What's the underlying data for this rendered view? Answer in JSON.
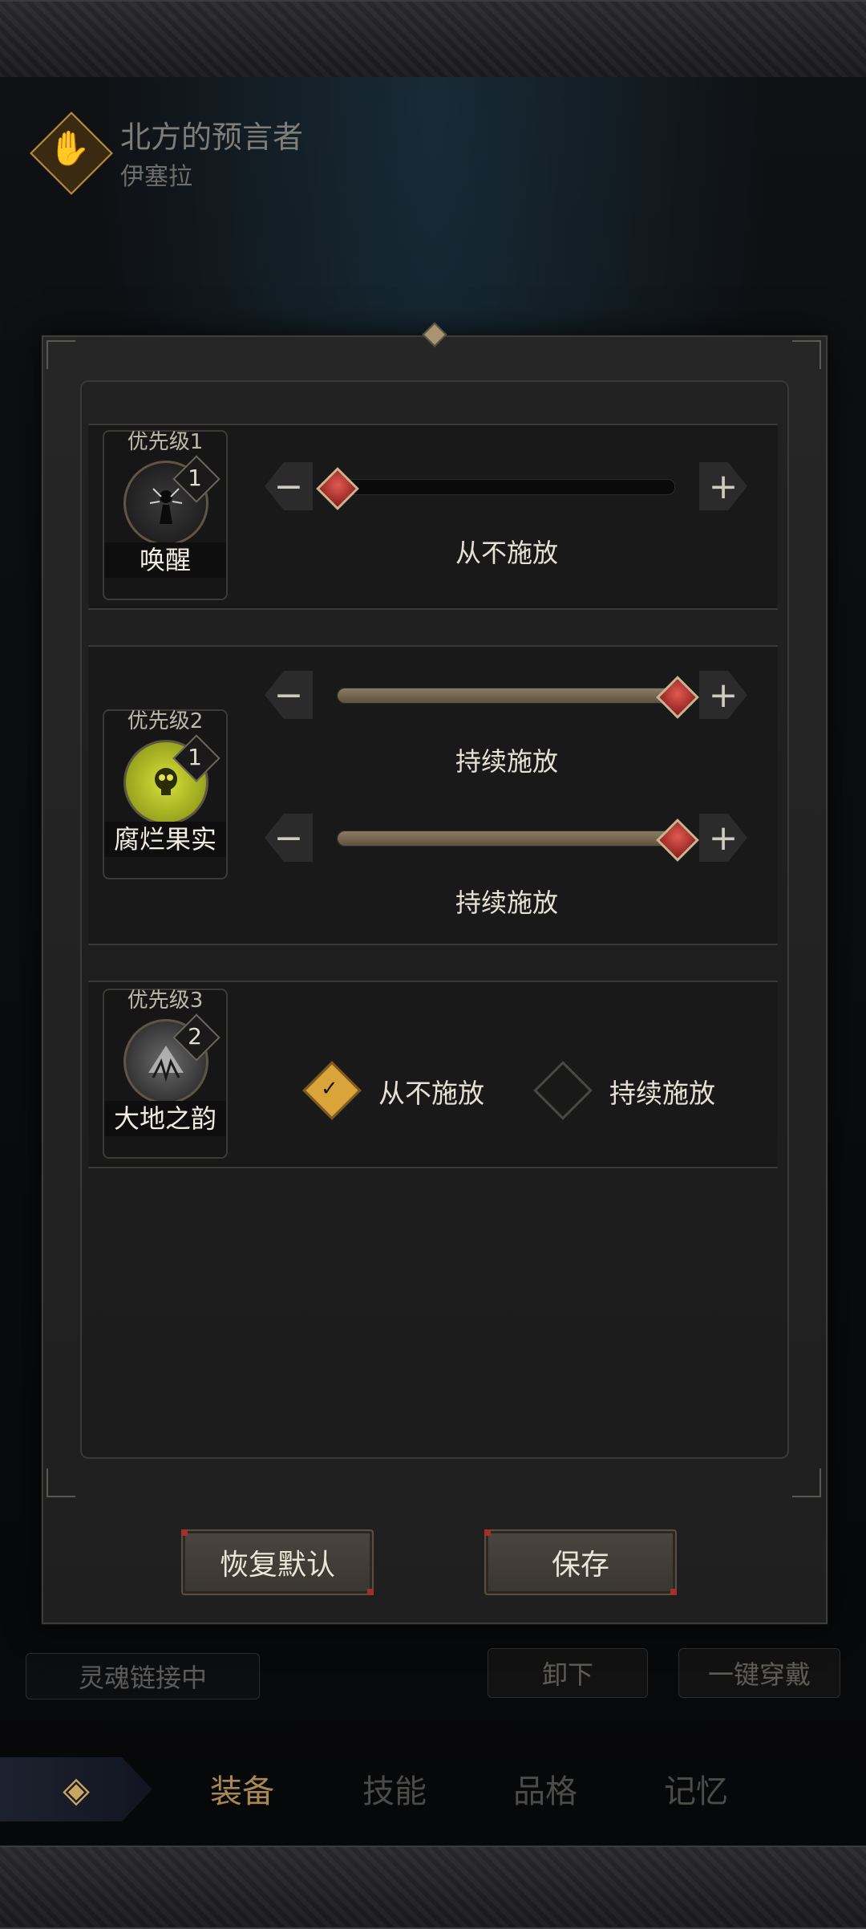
{
  "hero": {
    "name": "北方的预言者",
    "subtitle": "伊塞拉",
    "emblem_icon": "spiral-hand-icon"
  },
  "dialog": {
    "skills": [
      {
        "priority": "优先级1",
        "name": "唤醒",
        "level": "1",
        "icon": "awaken-icon",
        "controls": [
          {
            "type": "slider",
            "value": 0,
            "caption": "从不施放"
          }
        ]
      },
      {
        "priority": "优先级2",
        "name": "腐烂果实",
        "level": "1",
        "icon": "rotten-fruit-skull-icon",
        "controls": [
          {
            "type": "slider",
            "value": 1,
            "caption": "持续施放"
          },
          {
            "type": "slider",
            "value": 1,
            "caption": "持续施放"
          }
        ]
      },
      {
        "priority": "优先级3",
        "name": "大地之韵",
        "level": "2",
        "icon": "earth-rhythm-icon",
        "controls": [
          {
            "type": "radio",
            "options": [
              "从不施放",
              "持续施放"
            ],
            "selected": 0
          }
        ]
      }
    ],
    "minus_symbol": "−",
    "plus_symbol": "+",
    "reset_button": "恢复默认",
    "save_button": "保存"
  },
  "background": {
    "soul_link": "灵魂链接中",
    "unequip": "卸下",
    "equip_all": "一键穿戴",
    "tabs": [
      "装备",
      "技能",
      "品格",
      "记忆"
    ],
    "active_tab": 0
  },
  "colors": {
    "accent_gold": "#d9a53a",
    "slider_fill": "#8a7b63",
    "knob_red": "#c9302b"
  }
}
